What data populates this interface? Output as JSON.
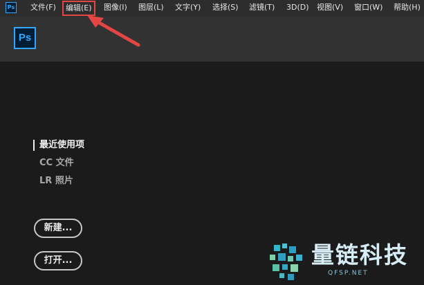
{
  "app": {
    "icon_label": "Ps",
    "logo_label": "Ps"
  },
  "menu": {
    "items": [
      {
        "label": "文件(F)"
      },
      {
        "label": "编辑(E)"
      },
      {
        "label": "图像(I)"
      },
      {
        "label": "图层(L)"
      },
      {
        "label": "文字(Y)"
      },
      {
        "label": "选择(S)"
      },
      {
        "label": "滤镜(T)"
      },
      {
        "label": "3D(D)"
      },
      {
        "label": "视图(V)"
      },
      {
        "label": "窗口(W)"
      },
      {
        "label": "帮助(H)"
      }
    ],
    "highlighted": "编辑(E)"
  },
  "home": {
    "nav": [
      {
        "label": "最近使用项",
        "active": true
      },
      {
        "label": "CC 文件",
        "active": false
      },
      {
        "label": "LR 照片",
        "active": false
      }
    ],
    "new_button": "新建...",
    "open_button": "打开..."
  },
  "watermark": {
    "text": "量链科技",
    "sub": "QFSP.NET"
  },
  "colors": {
    "menubar_bg": "#2d2d2d",
    "header_bg": "#323232",
    "workspace_bg": "#1b1b1b",
    "ps_blue": "#31a8ff",
    "annotation_red": "#e64545"
  }
}
